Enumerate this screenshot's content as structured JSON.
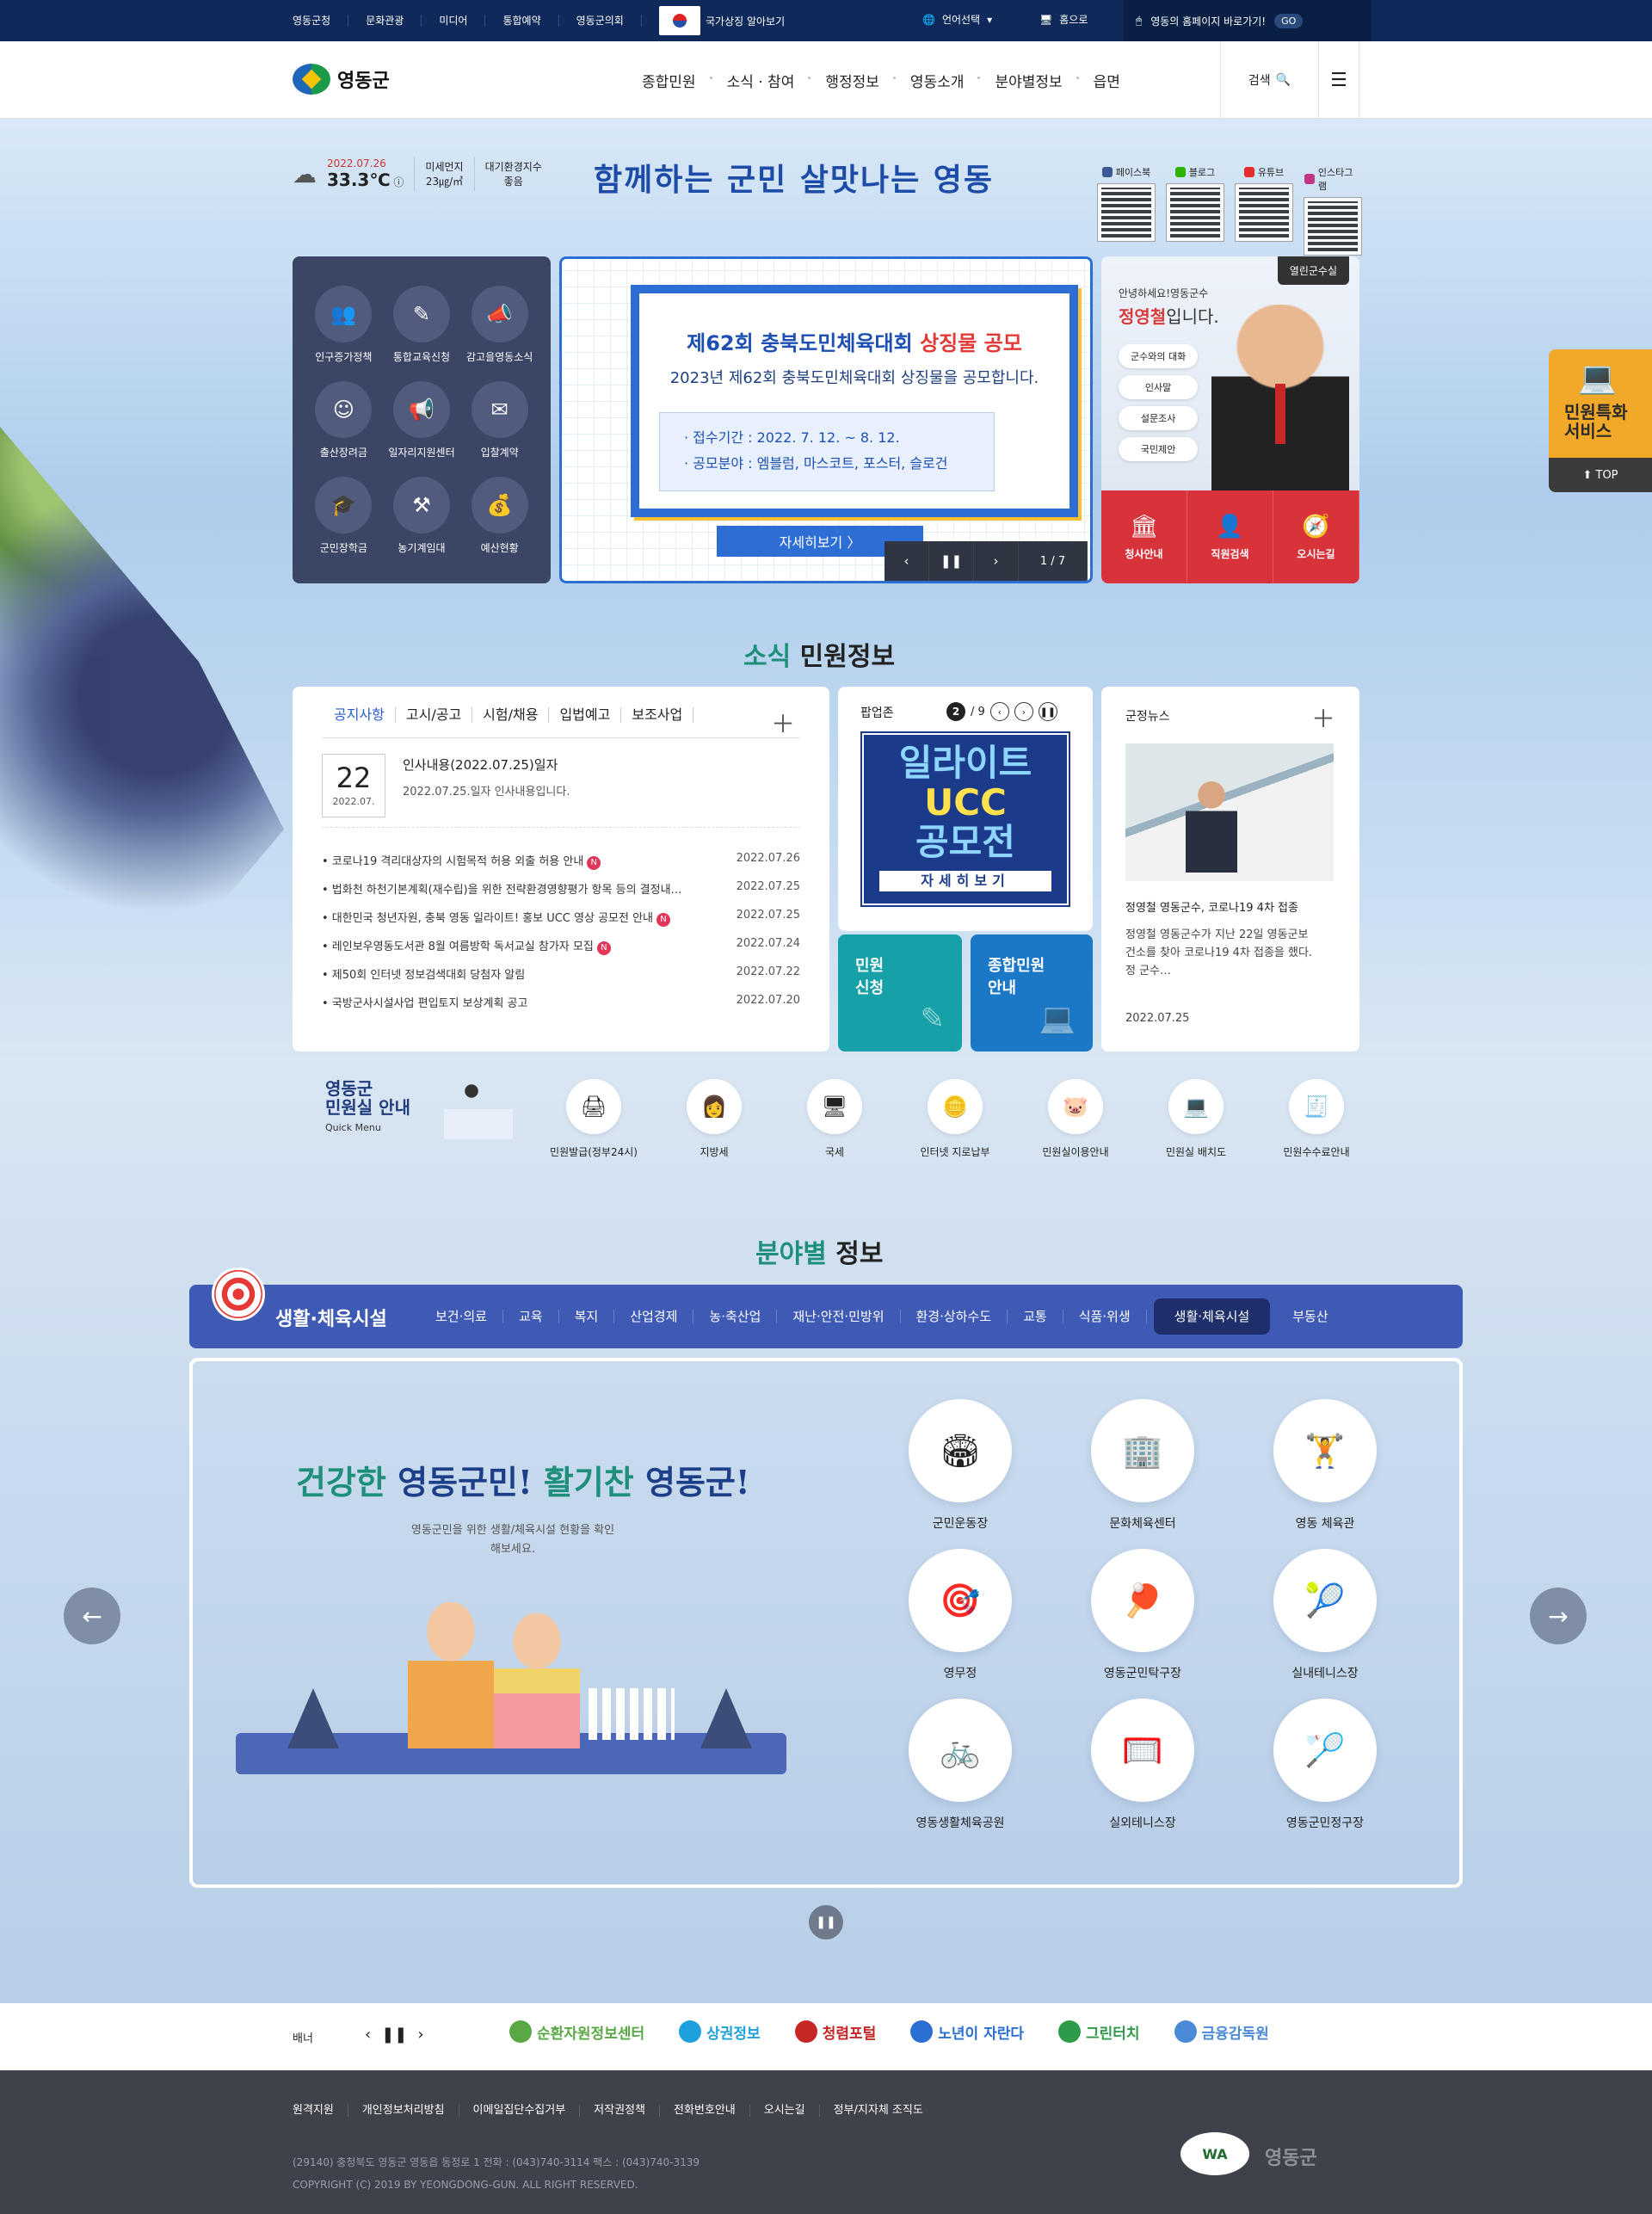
{
  "topbar": {
    "links": [
      "영동군청",
      "문화관광",
      "미디어",
      "통합예약",
      "영동군의회"
    ],
    "flag_label": "국가상징 알아보기",
    "lang_label": "언어선택",
    "home_label": "홈으로",
    "quick_go_label": "영동의 홈페이지 바로가기!",
    "go": "GO"
  },
  "header": {
    "logo_text": "영동군",
    "gnb": [
      "종합민원",
      "소식 · 참여",
      "행정정보",
      "영동소개",
      "분야별정보",
      "읍면"
    ],
    "search_label": "검색"
  },
  "weather": {
    "date": "2022.07.26",
    "temp": "33.3℃",
    "dust_label": "미세먼지",
    "dust_value": "23㎍/㎥",
    "air_label": "대기환경지수",
    "air_value": "좋음"
  },
  "slogan": "함께하는 군민 살맛나는 영동",
  "sns": [
    {
      "label": "페이스북",
      "color": "#3b5998"
    },
    {
      "label": "블로그",
      "color": "#2db400"
    },
    {
      "label": "유튜브",
      "color": "#e52d27"
    },
    {
      "label": "인스타그램",
      "color": "#c13584"
    }
  ],
  "quick_panel": [
    {
      "label": "인구증가정책",
      "icon": "people-icon",
      "glyph": "👥"
    },
    {
      "label": "통합교육신청",
      "icon": "pencil-icon",
      "glyph": "✎"
    },
    {
      "label": "감고을영동소식",
      "icon": "megaphone-icon",
      "glyph": "📣"
    },
    {
      "label": "출산장려금",
      "icon": "baby-icon",
      "glyph": "☺"
    },
    {
      "label": "일자리지원센터",
      "icon": "megaphone-icon",
      "glyph": "📢"
    },
    {
      "label": "입찰계약",
      "icon": "envelope-icon",
      "glyph": "✉"
    },
    {
      "label": "군민장학금",
      "icon": "graduation-cap-icon",
      "glyph": "🎓"
    },
    {
      "label": "농기계임대",
      "icon": "tools-icon",
      "glyph": "⚒"
    },
    {
      "label": "예산현황",
      "icon": "coins-icon",
      "glyph": "💰"
    }
  ],
  "main_banner": {
    "title_a": "제62회 충북도민체육대회 ",
    "title_b": "상징물 공모",
    "subtitle": "2023년 제62회 충북도민체육대회 상징물을 공모합니다.",
    "period": "· 접수기간 : 2022. 7. 12. ~ 8. 12.",
    "field": "· 공모분야 : 엠블럼, 마스코트, 포스터, 슬로건",
    "more": "자세히보기 〉",
    "page": "1 / 7"
  },
  "mayor": {
    "tag": "열린군수실",
    "greeting": "안녕하세요!영동군수",
    "name_b": "정영철",
    "name_rest": "입니다.",
    "options": [
      "군수와의 대화",
      "인사말",
      "설문조사",
      "국민제안"
    ],
    "bottom": [
      {
        "label": "청사안내",
        "glyph": "🏛"
      },
      {
        "label": "직원검색",
        "glyph": "👤"
      },
      {
        "label": "오시는길",
        "glyph": "🧭"
      }
    ]
  },
  "news_section": {
    "title_a": "소식 ",
    "title_b": "민원정보"
  },
  "notice": {
    "tabs": [
      "공지사항",
      "고시/공고",
      "시험/채용",
      "입법예고",
      "보조사업"
    ],
    "top_day": "22",
    "top_month": "2022.07.",
    "top_title": "인사내용(2022.07.25)일자",
    "top_desc": "2022.07.25.일자 인사내용입니다.",
    "items": [
      {
        "title": "코로나19 격리대상자의 시험목적 허용 외출 허용 안내",
        "new": true,
        "date": "2022.07.26"
      },
      {
        "title": "법화천 하천기본계획(재수립)을 위한 전략환경영향평가 항목 등의 결정내…",
        "new": false,
        "date": "2022.07.25"
      },
      {
        "title": "대한민국 청년자원, 충북 영동 일라이트! 홍보 UCC 영상 공모전 안내",
        "new": true,
        "date": "2022.07.25"
      },
      {
        "title": "레인보우영동도서관 8월 여름방학 독서교실 참가자 모집",
        "new": true,
        "date": "2022.07.24"
      },
      {
        "title": "제50회 인터넷 정보검색대회 당첨자 알림",
        "new": false,
        "date": "2022.07.22"
      },
      {
        "title": "국방군사시설사업 편입토지 보상계획 공고",
        "new": false,
        "date": "2022.07.20"
      }
    ],
    "new_badge": "N"
  },
  "popup": {
    "label": "팝업존",
    "current": "2",
    "total": "/ 9",
    "line1": "일라이트",
    "line2": "UCC",
    "line3": "공모전",
    "sub": "자세히보기"
  },
  "minwon": {
    "apply_l1": "민원",
    "apply_l2": "신청",
    "guide_l1": "종합민원",
    "guide_l2": "안내"
  },
  "news": {
    "label": "군정뉴스",
    "title": "정영철 영동군수, 코로나19 4차 접종",
    "desc": "정영철 영동군수가 지난 22일 영동군보건소를 찾아 코로나19 4차 접종을 했다. 정 군수…",
    "date": "2022.07.25"
  },
  "quick_menu": {
    "title_l1": "영동군",
    "title_l2": "민원실 안내",
    "title_en": "Quick Menu",
    "items": [
      {
        "label": "민원발급(정부24시)",
        "icon": "document-print-icon",
        "glyph": "🖨"
      },
      {
        "label": "지방세",
        "icon": "person-icon",
        "glyph": "👩"
      },
      {
        "label": "국세",
        "icon": "monitor-icon",
        "glyph": "🖥"
      },
      {
        "label": "인터넷 지로납부",
        "icon": "coin-icon",
        "glyph": "🪙"
      },
      {
        "label": "민원실이용안내",
        "icon": "piggy-bank-icon",
        "glyph": "🐷"
      },
      {
        "label": "민원실 배치도",
        "icon": "computer-icon",
        "glyph": "💻"
      },
      {
        "label": "민원수수료안내",
        "icon": "receipt-icon",
        "glyph": "🧾"
      }
    ]
  },
  "field_section": {
    "title_a": "분야별 ",
    "title_b": "정보"
  },
  "field_bar": {
    "title": "생활·체육시설",
    "cats": [
      "보건·의료",
      "교육",
      "복지",
      "산업경제",
      "농·축산업",
      "재난·안전·민방위",
      "환경·상하수도",
      "교통",
      "식품·위생",
      "생활·체육시설",
      "부동산"
    ],
    "active": "생활·체육시설"
  },
  "field_box": {
    "head_a": "건강한",
    "head_b": " 영동군민! ",
    "head_c": "활기찬",
    "head_d": " 영동군!",
    "desc": "영동군민을 위한 생활/체육시설 현황을 확인해보세요.",
    "facilities": [
      {
        "label": "군민운동장",
        "icon": "stadium-icon",
        "glyph": "🏟"
      },
      {
        "label": "문화체육센터",
        "icon": "building-icon",
        "glyph": "🏢"
      },
      {
        "label": "영동 체육관",
        "icon": "dumbbell-icon",
        "glyph": "🏋"
      },
      {
        "label": "영무정",
        "icon": "archery-target-icon",
        "glyph": "🎯"
      },
      {
        "label": "영동군민탁구장",
        "icon": "ping-pong-icon",
        "glyph": "🏓"
      },
      {
        "label": "실내테니스장",
        "icon": "tennis-racket-icon",
        "glyph": "🎾"
      },
      {
        "label": "영동생활체육공원",
        "icon": "bicycle-icon",
        "glyph": "🚲"
      },
      {
        "label": "실외테니스장",
        "icon": "tennis-court-icon",
        "glyph": "🥅"
      },
      {
        "label": "영동군민정구장",
        "icon": "racket-icon",
        "glyph": "🏸"
      }
    ]
  },
  "side": {
    "title_l1": "민원특화",
    "title_l2": "서비스",
    "top": "TOP"
  },
  "banner_strip": {
    "label": "배너",
    "logos": [
      {
        "label": "순환자원정보센터",
        "color": "#5aa845"
      },
      {
        "label": "상권정보",
        "color": "#1ea0dc"
      },
      {
        "label": "청렴포털",
        "color": "#c62828"
      },
      {
        "label": "노년이 자란다",
        "color": "#2a6fd1"
      },
      {
        "label": "그린터치",
        "color": "#2e9b48"
      },
      {
        "label": "금융감독원",
        "color": "#4b8ad6"
      }
    ]
  },
  "footer": {
    "nav": [
      "원격지원",
      "개인정보처리방침",
      "이메일집단수집거부",
      "저작권정책",
      "전화번호안내",
      "오시는길",
      "정부/지자체 조직도"
    ],
    "address": "(29140) 충청북도 영동군 영동읍 동정로 1    전화 : (043)740-3114    팩스 : (043)740-3139",
    "copyright": "COPYRIGHT (C) 2019 BY YEONGDONG-GUN. ALL RIGHT RESERVED.",
    "wa": "WA",
    "logo": "영동군"
  }
}
